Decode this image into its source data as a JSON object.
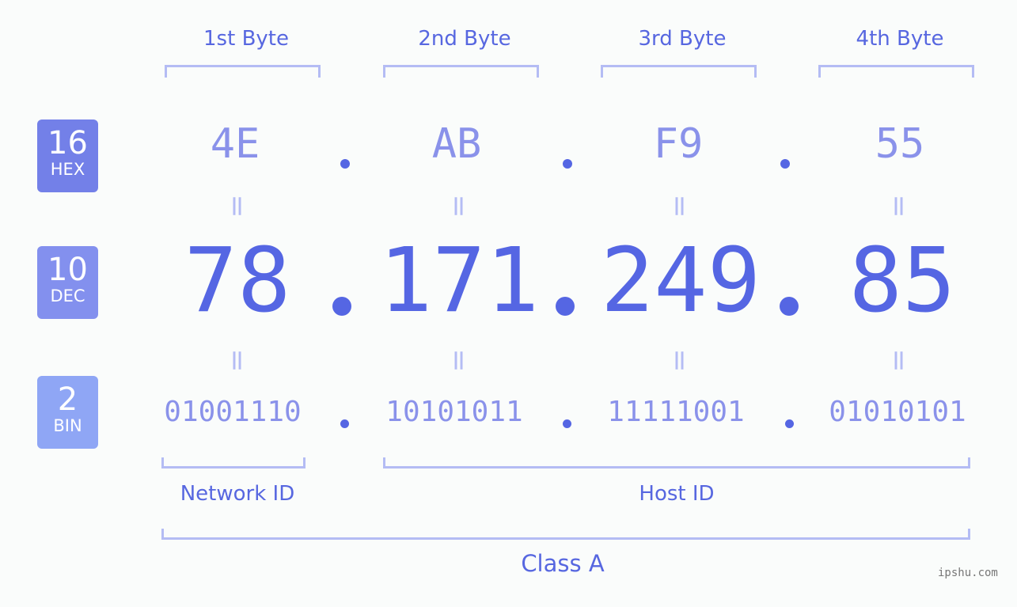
{
  "bases": [
    {
      "num": "16",
      "label": "HEX",
      "color": "#7380e8"
    },
    {
      "num": "10",
      "label": "DEC",
      "color": "#8390ee"
    },
    {
      "num": "2",
      "label": "BIN",
      "color": "#8fa6f5"
    }
  ],
  "byte_headers": [
    "1st Byte",
    "2nd Byte",
    "3rd Byte",
    "4th Byte"
  ],
  "hex": [
    "4E",
    "AB",
    "F9",
    "55"
  ],
  "dec": [
    "78",
    "171",
    "249",
    "85"
  ],
  "bin": [
    "01001110",
    "10101011",
    "11111001",
    "01010101"
  ],
  "equals_symbol": "=",
  "network_label": "Network ID",
  "host_label": "Host ID",
  "class_label": "Class A",
  "watermark": "ipshu.com"
}
